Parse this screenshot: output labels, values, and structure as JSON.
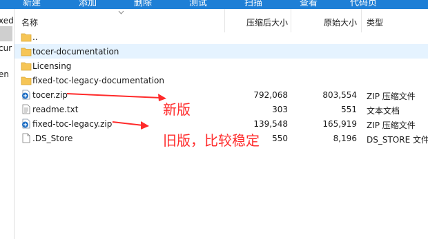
{
  "toolbar": {
    "buttons": [
      "新建",
      "添加",
      "删除",
      "测试",
      "扫描",
      "查看",
      "代码页"
    ]
  },
  "tree": {
    "items": [
      "xed",
      "cur",
      "en"
    ]
  },
  "columns": {
    "name": "名称",
    "compressed_size": "压缩后大小",
    "original_size": "原始大小",
    "type": "类型"
  },
  "files": [
    {
      "name": "..",
      "icon": "folder-icon",
      "compressed": "",
      "original": "",
      "type": ""
    },
    {
      "name": "tocer-documentation",
      "icon": "folder-icon",
      "compressed": "",
      "original": "",
      "type": ""
    },
    {
      "name": "Licensing",
      "icon": "folder-icon",
      "compressed": "",
      "original": "",
      "type": ""
    },
    {
      "name": "fixed-toc-legacy-documentation",
      "icon": "folder-icon",
      "compressed": "",
      "original": "",
      "type": ""
    },
    {
      "name": "tocer.zip",
      "icon": "zip-icon",
      "compressed": "792,068",
      "original": "803,554",
      "type": "ZIP 压缩文件"
    },
    {
      "name": "readme.txt",
      "icon": "text-file-icon",
      "compressed": "303",
      "original": "551",
      "type": "文本文档"
    },
    {
      "name": "fixed-toc-legacy.zip",
      "icon": "zip-icon",
      "compressed": "139,548",
      "original": "165,919",
      "type": "ZIP 压缩文件"
    },
    {
      "name": ".DS_Store",
      "icon": "blank-file-icon",
      "compressed": "550",
      "original": "8,196",
      "type": "DS_STORE 文件"
    }
  ],
  "annotations": {
    "new_label": "新版",
    "old_label": "旧版，比较稳定"
  },
  "colors": {
    "toolbar": "#1e7fd6",
    "hover_row": "#e5f3ff",
    "annotation": "#ff2a2a",
    "folder": "#f6c555"
  }
}
